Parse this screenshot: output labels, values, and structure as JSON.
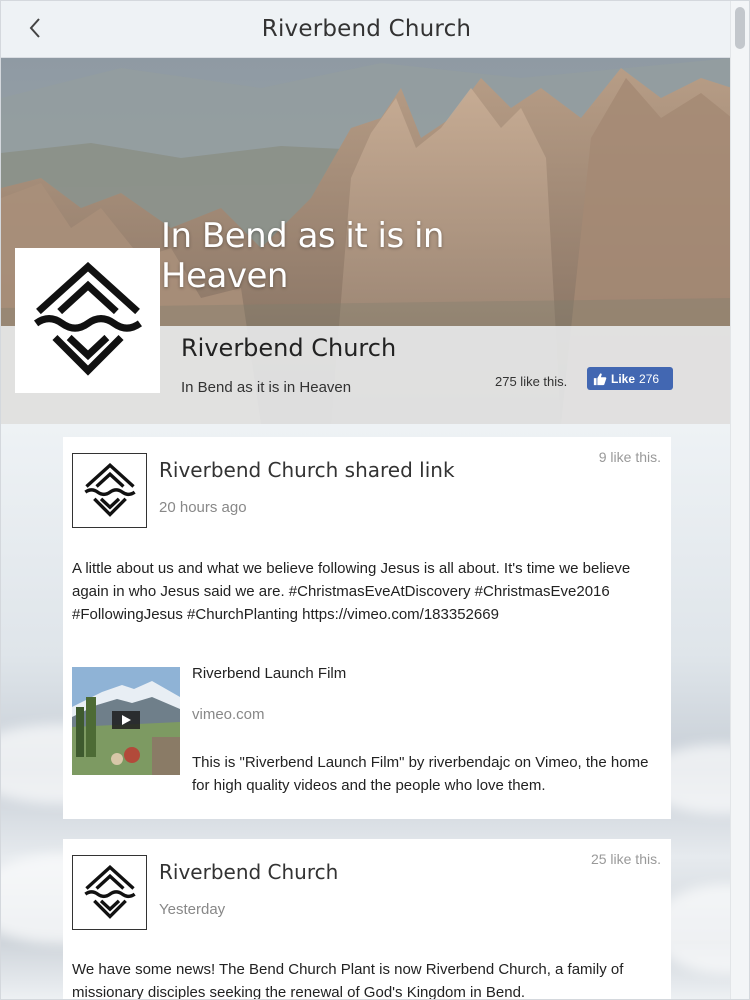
{
  "header": {
    "title": "Riverbend Church",
    "back_icon": "chevron-left-icon"
  },
  "hero": {
    "tagline": "In Bend as it is in Heaven",
    "page_name": "Riverbend Church",
    "subtitle": "In Bend as it is in Heaven",
    "like_text": "275 like this.",
    "like_button": {
      "label": "Like",
      "count": "276",
      "color": "#4267b2",
      "icon": "thumbs-up-icon"
    }
  },
  "posts": [
    {
      "author": "Riverbend Church shared link",
      "time": "20 hours ago",
      "likes": "9 like this.",
      "text": "A little about us and what we believe following Jesus is all about. It's time we believe again in who Jesus said we are. #ChristmasEveAtDiscovery #ChristmasEve2016 #FollowingJesus #ChurchPlanting https://vimeo.com/183352669",
      "link": {
        "title": "Riverbend Launch Film",
        "domain": "vimeo.com",
        "description": "This is \"Riverbend Launch Film\" by riverbendajc on Vimeo, the home for high quality videos and the people who love them.",
        "thumb_icon": "play-icon"
      }
    },
    {
      "author": "Riverbend Church",
      "time": "Yesterday",
      "likes": "25 like this.",
      "text": "We have some news! The Bend Church Plant is now Riverbend Church, a family of missionary disciples seeking the renewal of God's Kingdom in Bend."
    }
  ]
}
